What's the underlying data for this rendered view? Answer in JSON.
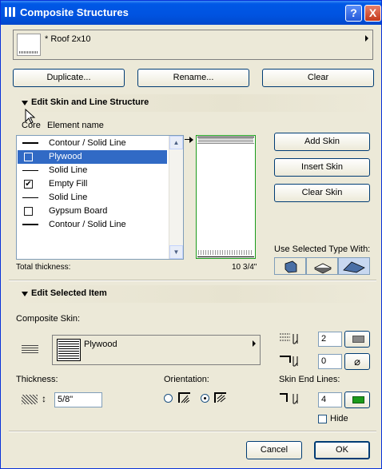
{
  "window": {
    "title": "Composite Structures",
    "help_label": "?",
    "close_label": "X"
  },
  "selector": {
    "value": "* Roof 2x10"
  },
  "top_buttons": {
    "duplicate": "Duplicate...",
    "rename": "Rename...",
    "clear": "Clear"
  },
  "skin_section": {
    "title": "Edit Skin and Line Structure",
    "col_core": "Core",
    "col_name": "Element name",
    "rows": [
      {
        "label": "Contour / Solid Line",
        "kind": "line",
        "weight": "thick"
      },
      {
        "label": "Plywood",
        "kind": "checkbox",
        "checked": false,
        "selected": true
      },
      {
        "label": "Solid Line",
        "kind": "line",
        "weight": "thin"
      },
      {
        "label": "Empty Fill",
        "kind": "checkbox",
        "checked": true
      },
      {
        "label": "Solid Line",
        "kind": "line",
        "weight": "thin"
      },
      {
        "label": "Gypsum Board",
        "kind": "checkbox",
        "checked": false
      },
      {
        "label": "Contour / Solid Line",
        "kind": "line",
        "weight": "thick"
      }
    ],
    "total_thickness_label": "Total thickness:",
    "total_thickness_value": "10 3/4\"",
    "add_skin": "Add Skin",
    "insert_skin": "Insert Skin",
    "clear_skin": "Clear Skin",
    "use_selected_label": "Use Selected Type With:"
  },
  "item_section": {
    "title": "Edit Selected Item",
    "composite_skin_label": "Composite Skin:",
    "fill_name": "Plywood",
    "pen_value_1": "2",
    "pen_value_2": "0",
    "thickness_label": "Thickness:",
    "thickness_value": "5/8\"",
    "orientation_label": "Orientation:",
    "skin_end_lines_label": "Skin End Lines:",
    "end_line_pen": "4",
    "hide_label": "Hide",
    "hide_checked": false,
    "accent_green": "#1a9a1a"
  },
  "footer": {
    "cancel": "Cancel",
    "ok": "OK"
  }
}
